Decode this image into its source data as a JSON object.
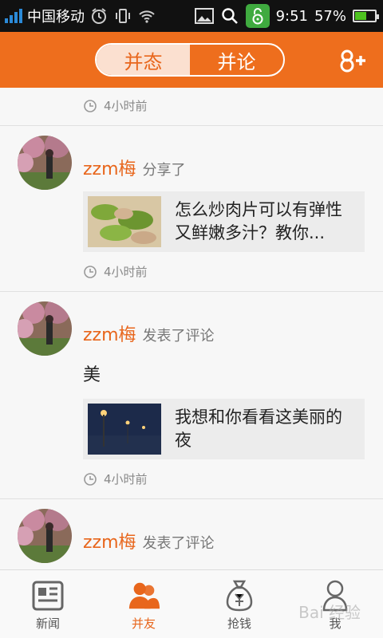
{
  "status_bar": {
    "carrier": "中国移动",
    "time": "9:51",
    "battery": "57%",
    "battery_level": 0.57,
    "icons": [
      "signal-icon",
      "alarm-icon",
      "vibrate-icon",
      "wifi-icon",
      "image-icon",
      "search-icon",
      "unlock-icon",
      "battery-icon"
    ]
  },
  "header": {
    "tabs": [
      {
        "label": "并态",
        "active": true
      },
      {
        "label": "并论",
        "active": false
      }
    ],
    "right_button": "8+"
  },
  "feed": {
    "top_time": "4小时前",
    "items": [
      {
        "username": "zzm梅",
        "action": "分享了",
        "card_text": "怎么炒肉片可以有弹性又鲜嫩多汁？教你...",
        "time": "4小时前"
      },
      {
        "username": "zzm梅",
        "action": "发表了评论",
        "comment": "美",
        "card_text": "我想和你看看这美丽的夜",
        "time": "4小时前"
      },
      {
        "username": "zzm梅",
        "action": "发表了评论"
      }
    ]
  },
  "bottom_nav": [
    {
      "label": "新闻",
      "icon": "news-icon",
      "active": false
    },
    {
      "label": "并友",
      "icon": "friends-icon",
      "active": true
    },
    {
      "label": "抢钱",
      "icon": "money-bag-icon",
      "active": false
    },
    {
      "label": "我",
      "icon": "profile-icon",
      "active": false
    }
  ],
  "watermark": "Bai 经验",
  "colors": {
    "accent": "#ee6e1d",
    "username": "#e8661c"
  }
}
